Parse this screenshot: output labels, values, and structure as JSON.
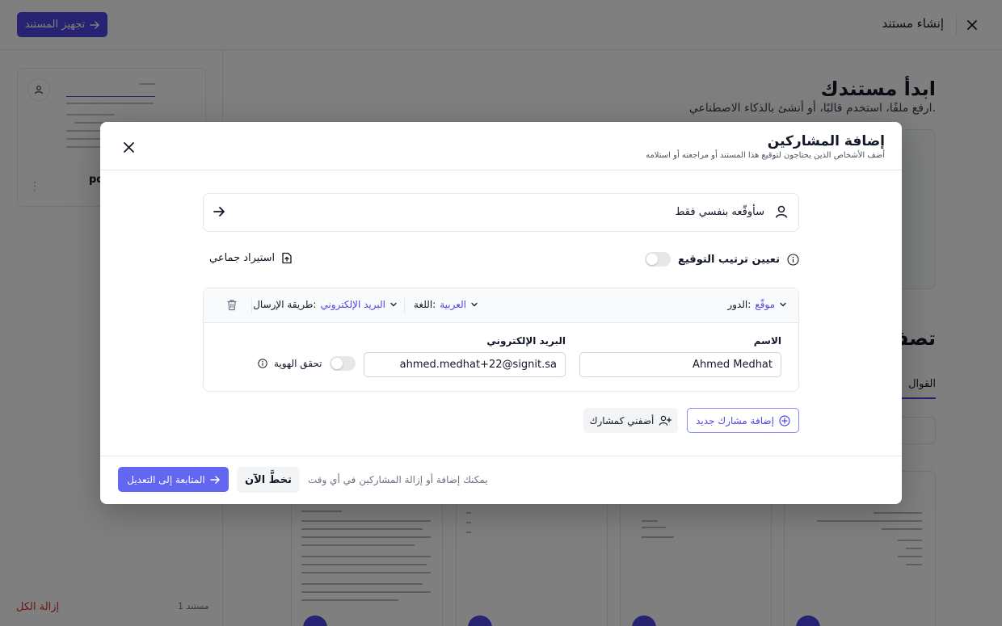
{
  "topbar": {
    "title": "إنشاء مستند",
    "prepare_button": "تجهيز المستند"
  },
  "left_panel": {
    "file_name": "pd",
    "doc_count": "1 مستند",
    "remove_all": "إزالة الكل"
  },
  "background": {
    "title": "ابدأ مستندك",
    "subtitle": "ارفع ملفًا، استخدم قالبًا، أو أنشئ بالذكاء الاصطناعي.",
    "browse_title": "تصفّ",
    "templates_tab": "القوال"
  },
  "modal": {
    "title": "إضافة المشاركين",
    "subtitle": "أضف الأشخاص الذين يحتاجون لتوقيع هذا المستند أو مراجعته أو استلامه",
    "self_sign_label": "سأوقّعه بنفسي فقط",
    "signing_order_label": "تعيين ترتيب التوقيع",
    "bulk_import_label": "استيراد جماعي",
    "participant": {
      "role_label": "الدور:",
      "role_value": "موقّع",
      "language_label": "اللغة:",
      "language_value": "العربية",
      "delivery_label": "طريقة الإرسال:",
      "delivery_value": "البريد الإلكتروني",
      "name_label": "الاسم",
      "name_value": "Ahmed Medhat",
      "email_label": "البريد الإلكتروني",
      "email_value": "ahmed.medhat+22@signit.sa",
      "verify_identity_label": "تحقق الهوية"
    },
    "add_new_button": "إضافة مشارك جديد",
    "add_me_button": "أضفني كمشارك",
    "footer_note": "يمكنك إضافة أو إزالة المشاركين في أي وقت",
    "skip_button": "تخطَّ الآن",
    "continue_button": "المتابعة إلى التعديل"
  },
  "colors": {
    "accent": "#4f46e5",
    "primary_button": "#6366f1",
    "danger": "#dc2626"
  }
}
